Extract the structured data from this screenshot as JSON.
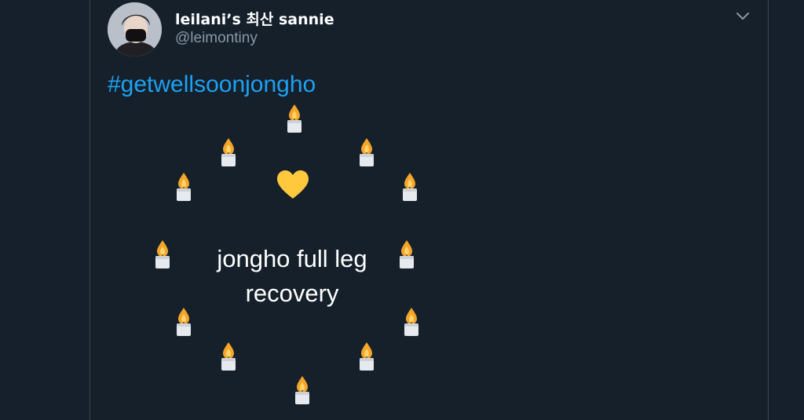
{
  "tweet": {
    "author_name": "leilani’s 최산 sannie",
    "author_handle": "@leimontiny",
    "hashtag": "#getwellsoonjongho",
    "message_lines": [
      "jongho full leg",
      "recovery"
    ],
    "icons": {
      "menu": "chevron-down-icon",
      "candle": "candle-icon",
      "heart": "yellow-heart-icon"
    }
  },
  "colors": {
    "background": "#15202b",
    "hashtag": "#1da1f2",
    "handle": "#8899a6",
    "text": "#ffffff",
    "heart": "#ffc83d",
    "flame": "#f4a52a"
  }
}
